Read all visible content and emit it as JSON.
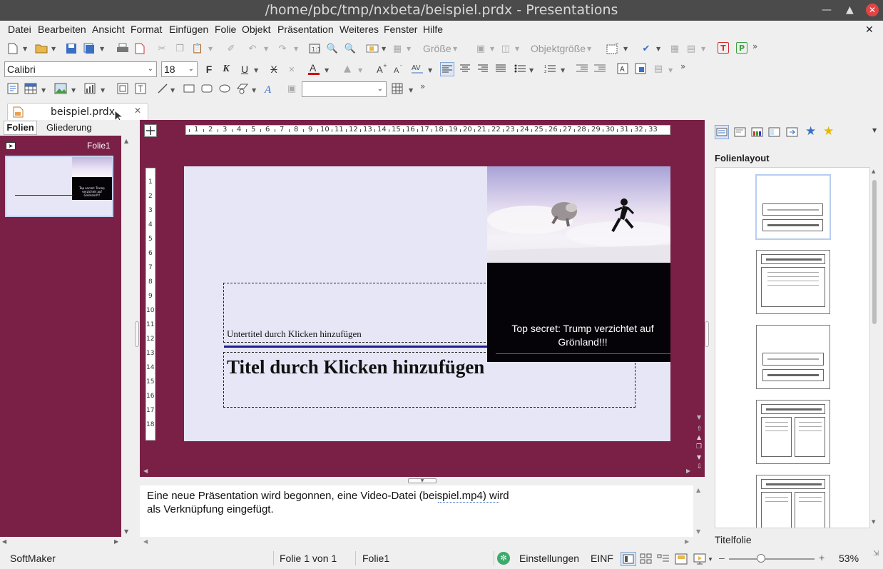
{
  "window": {
    "title": "/home/pbc/tmp/nxbeta/beispiel.prdx - Presentations"
  },
  "menu": [
    "Datei",
    "Bearbeiten",
    "Ansicht",
    "Format",
    "Einfügen",
    "Folie",
    "Objekt",
    "Präsentation",
    "Weiteres",
    "Fenster",
    "Hilfe"
  ],
  "toolbar": {
    "size_label": "Größe",
    "object_size_label": "Objektgröße",
    "font_name": "Calibri",
    "font_size": "18",
    "bold": "F",
    "italic": "K",
    "underline": "U",
    "strike": "X",
    "t_label": "T",
    "p_label": "P"
  },
  "tabs": {
    "document": "beispiel.prdx"
  },
  "left_panel": {
    "tab_slides": "Folien",
    "tab_outline": "Gliederung",
    "slide_name": "Folie1",
    "thumb_text": "Top secret: Trump verzichtet auf Grönland!!!"
  },
  "ruler": {
    "h_ticks": [
      "1",
      "2",
      "3",
      "4",
      "5",
      "6",
      "7",
      "8",
      "9",
      "10",
      "11",
      "12",
      "13",
      "14",
      "15",
      "16",
      "17",
      "18",
      "19",
      "20",
      "21",
      "22",
      "23",
      "24",
      "25",
      "26",
      "27",
      "28",
      "29",
      "30",
      "31",
      "32",
      "33"
    ],
    "v_ticks": [
      "1",
      "2",
      "3",
      "4",
      "5",
      "6",
      "7",
      "8",
      "9",
      "10",
      "11",
      "12",
      "13",
      "14",
      "15",
      "16",
      "17",
      "18"
    ]
  },
  "slide": {
    "subtitle_placeholder": "Untertitel durch Klicken hinzufügen",
    "title_placeholder": "Titel durch Klicken hinzufügen",
    "video_caption": "Top secret: Trump verzichtet auf Grönland!!!"
  },
  "notes": {
    "line1": "Eine neue Präsentation wird begonnen, eine Video-Datei (beispiel.mp4) wird",
    "line2": "als Verknüpfung eingefügt."
  },
  "right_panel": {
    "heading": "Folienlayout",
    "selected_layout_name": "Titelfolie"
  },
  "status": {
    "app": "SoftMaker",
    "page": "Folie 1 von 1",
    "slide": "Folie1",
    "settings": "Einstellungen",
    "mode": "EINF",
    "zoom": "53%",
    "zoom_level": 0.53
  },
  "colors": {
    "workspace": "#7a2047",
    "slide_bg": "#e6e6f6",
    "accent_line": "#1c1c8c",
    "font_color": "#d00000"
  }
}
